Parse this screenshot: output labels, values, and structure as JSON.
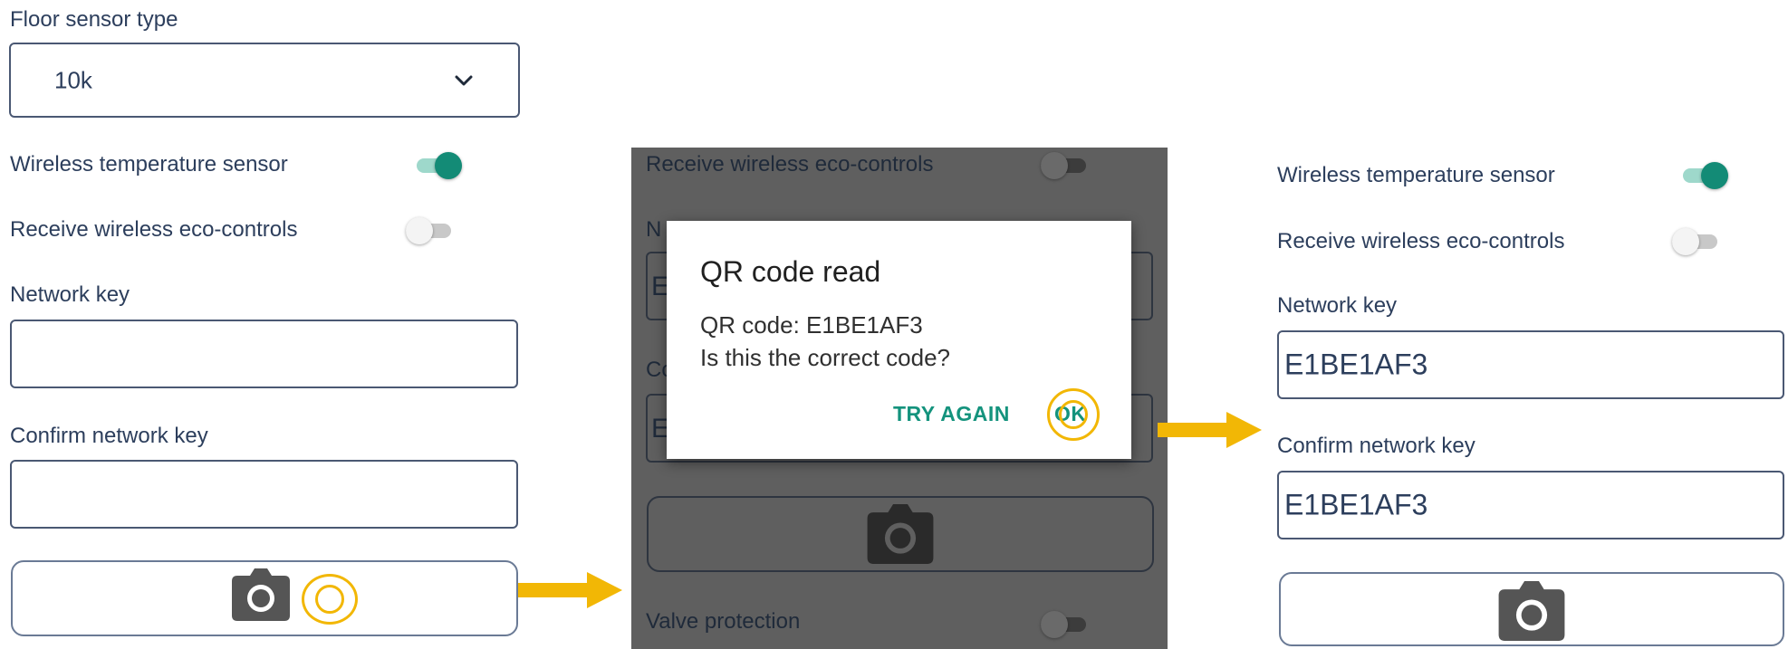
{
  "left_panel": {
    "floor_sensor_label": "Floor sensor type",
    "floor_sensor_value": "10k",
    "wireless_temp_label": "Wireless temperature sensor",
    "eco_controls_label": "Receive wireless eco-controls",
    "network_key_label": "Network key",
    "network_key_value": "",
    "confirm_key_label": "Confirm network key",
    "confirm_key_value": "",
    "wireless_temp_on": true,
    "eco_controls_on": false
  },
  "middle_panel": {
    "eco_controls_label": "Receive wireless eco-controls",
    "eco_controls_on": false,
    "network_label_partial": "N",
    "network_value_partial": "E",
    "confirm_label_partial": "Co",
    "confirm_value_partial": "E",
    "valve_protection_label": "Valve protection",
    "valve_protection_on": false,
    "dialog": {
      "title": "QR code read",
      "line1": "QR code: E1BE1AF3",
      "line2": "Is this the correct code?",
      "try_again": "TRY AGAIN",
      "ok": "OK"
    }
  },
  "right_panel": {
    "wireless_temp_label": "Wireless temperature sensor",
    "eco_controls_label": "Receive wireless eco-controls",
    "network_key_label": "Network key",
    "network_key_value": "E1BE1AF3",
    "confirm_key_label": "Confirm network key",
    "confirm_key_value": "E1BE1AF3",
    "wireless_temp_on": true,
    "eco_controls_on": false
  },
  "icons": {
    "camera": "camera-icon",
    "chevron": "chevron-down-icon",
    "arrow": "arrow-right-icon",
    "highlight": "tap-highlight-ring"
  },
  "colors": {
    "accent_green": "#138b76",
    "highlight_yellow": "#f2b705",
    "text": "#2c3e5c",
    "dim_overlay": "#5f5f5f"
  }
}
